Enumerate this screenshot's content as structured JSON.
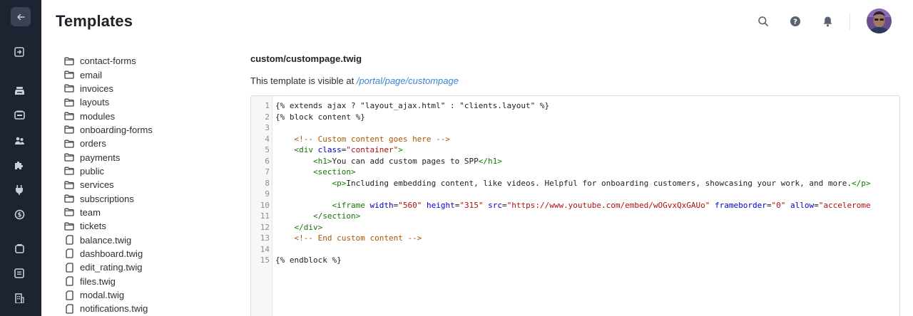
{
  "page": {
    "title": "Templates"
  },
  "header": {
    "icons": [
      "search-icon",
      "help-icon",
      "bell-icon"
    ]
  },
  "rail": {
    "icons": [
      "arrow-left-icon",
      "sign-in-icon",
      "inbox-icon",
      "ticket-icon",
      "users-icon",
      "puzzle-icon",
      "plug-icon",
      "billing-icon",
      "box-icon",
      "document-icon",
      "building-icon"
    ]
  },
  "tree": {
    "items": [
      {
        "label": "contact-forms",
        "type": "folder"
      },
      {
        "label": "email",
        "type": "folder"
      },
      {
        "label": "invoices",
        "type": "folder"
      },
      {
        "label": "layouts",
        "type": "folder"
      },
      {
        "label": "modules",
        "type": "folder"
      },
      {
        "label": "onboarding-forms",
        "type": "folder"
      },
      {
        "label": "orders",
        "type": "folder"
      },
      {
        "label": "payments",
        "type": "folder"
      },
      {
        "label": "public",
        "type": "folder"
      },
      {
        "label": "services",
        "type": "folder"
      },
      {
        "label": "subscriptions",
        "type": "folder"
      },
      {
        "label": "team",
        "type": "folder"
      },
      {
        "label": "tickets",
        "type": "folder"
      },
      {
        "label": "balance.twig",
        "type": "file"
      },
      {
        "label": "dashboard.twig",
        "type": "file"
      },
      {
        "label": "edit_rating.twig",
        "type": "file"
      },
      {
        "label": "files.twig",
        "type": "file"
      },
      {
        "label": "modal.twig",
        "type": "file"
      },
      {
        "label": "notifications.twig",
        "type": "file"
      }
    ]
  },
  "template": {
    "name": "custom/custompage.twig",
    "visible_prefix": "This template is visible at ",
    "visible_link": "/portal/page/custompage"
  },
  "editor": {
    "lines": [
      [
        {
          "t": "{% extends ajax ? \"layout_ajax.html\" : \"clients.layout\" %}",
          "c": ""
        }
      ],
      [
        {
          "t": "{% block content %}",
          "c": ""
        }
      ],
      [],
      [
        {
          "t": "    ",
          "c": ""
        },
        {
          "t": "<!-- Custom content goes here -->",
          "c": "comment"
        }
      ],
      [
        {
          "t": "    ",
          "c": ""
        },
        {
          "t": "<div ",
          "c": "tag"
        },
        {
          "t": "class",
          "c": "attr"
        },
        {
          "t": "=",
          "c": ""
        },
        {
          "t": "\"container\"",
          "c": "str"
        },
        {
          "t": ">",
          "c": "tag"
        }
      ],
      [
        {
          "t": "        ",
          "c": ""
        },
        {
          "t": "<h1>",
          "c": "tag"
        },
        {
          "t": "You can add custom pages to SPP",
          "c": ""
        },
        {
          "t": "</h1>",
          "c": "tag"
        }
      ],
      [
        {
          "t": "        ",
          "c": ""
        },
        {
          "t": "<section>",
          "c": "tag"
        }
      ],
      [
        {
          "t": "            ",
          "c": ""
        },
        {
          "t": "<p>",
          "c": "tag"
        },
        {
          "t": "Including embedding content, like videos. Helpful for onboarding customers, showcasing your work, and more.",
          "c": ""
        },
        {
          "t": "</p>",
          "c": "tag"
        }
      ],
      [],
      [
        {
          "t": "            ",
          "c": ""
        },
        {
          "t": "<iframe ",
          "c": "tag"
        },
        {
          "t": "width",
          "c": "attr"
        },
        {
          "t": "=",
          "c": ""
        },
        {
          "t": "\"560\"",
          "c": "str"
        },
        {
          "t": " ",
          "c": ""
        },
        {
          "t": "height",
          "c": "attr"
        },
        {
          "t": "=",
          "c": ""
        },
        {
          "t": "\"315\"",
          "c": "str"
        },
        {
          "t": " ",
          "c": ""
        },
        {
          "t": "src",
          "c": "attr"
        },
        {
          "t": "=",
          "c": ""
        },
        {
          "t": "\"https://www.youtube.com/embed/wOGvxQxGAUo\"",
          "c": "str"
        },
        {
          "t": " ",
          "c": ""
        },
        {
          "t": "frameborder",
          "c": "attr"
        },
        {
          "t": "=",
          "c": ""
        },
        {
          "t": "\"0\"",
          "c": "str"
        },
        {
          "t": " ",
          "c": ""
        },
        {
          "t": "allow",
          "c": "attr"
        },
        {
          "t": "=",
          "c": ""
        },
        {
          "t": "\"accelerome",
          "c": "str"
        }
      ],
      [
        {
          "t": "        ",
          "c": ""
        },
        {
          "t": "</section>",
          "c": "tag"
        }
      ],
      [
        {
          "t": "    ",
          "c": ""
        },
        {
          "t": "</div>",
          "c": "tag"
        }
      ],
      [
        {
          "t": "    ",
          "c": ""
        },
        {
          "t": "<!-- End custom content -->",
          "c": "comment"
        }
      ],
      [],
      [
        {
          "t": "{% endblock %}",
          "c": ""
        }
      ]
    ]
  },
  "colors": {
    "rail_bg": "#1c2331",
    "link": "#3a86d4"
  }
}
